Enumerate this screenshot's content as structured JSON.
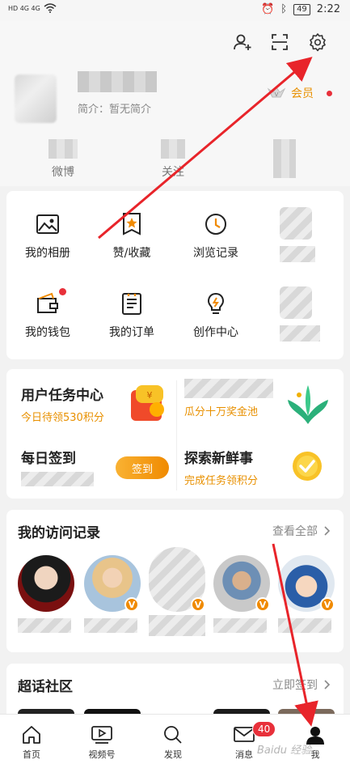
{
  "status_bar": {
    "left_text": "HD 4G 4G",
    "battery": "49",
    "time": "2:22"
  },
  "profile": {
    "intro": "简介：暂无简介",
    "vip_label": "会员",
    "stats": [
      {
        "label": "微博"
      },
      {
        "label": "关注"
      },
      {
        "label": "粉丝"
      }
    ]
  },
  "grid": {
    "items": [
      {
        "label": "我的相册",
        "icon": "photo-icon"
      },
      {
        "label": "赞/收藏",
        "icon": "star-bookmark-icon"
      },
      {
        "label": "浏览记录",
        "icon": "history-icon"
      },
      {
        "label": "草稿箱",
        "icon": "blurred-icon"
      },
      {
        "label": "我的钱包",
        "icon": "wallet-icon"
      },
      {
        "label": "我的订单",
        "icon": "order-icon"
      },
      {
        "label": "创作中心",
        "icon": "bulb-icon"
      },
      {
        "label": "粉丝服务",
        "icon": "blurred-icon"
      }
    ]
  },
  "tasks": {
    "task_center_title": "用户任务中心",
    "task_center_sub": "今日待领530积分",
    "right_top_sub": "瓜分十万奖金池",
    "left_bottom_title": "每日签到",
    "left_bottom_sub": "",
    "sign_in_button": "签到",
    "explore_title": "探索新鲜事",
    "explore_sub": "完成任务领积分"
  },
  "visits": {
    "title": "我的访问记录",
    "more": "查看全部",
    "items": [
      {
        "color": "#5a1e1e",
        "badge": ""
      },
      {
        "color": "#dcc9a4",
        "badge": "V"
      },
      {
        "color": "#b9b9b9",
        "badge": "V"
      },
      {
        "color": "#8aa9c9",
        "badge": "V"
      },
      {
        "color": "#3a7fc5",
        "badge": "V"
      }
    ]
  },
  "super_topic": {
    "title": "超话社区",
    "more": "立即签到"
  },
  "bottom_nav": {
    "items": [
      {
        "label": "首页",
        "icon": "home-icon"
      },
      {
        "label": "视频号",
        "icon": "video-icon"
      },
      {
        "label": "发现",
        "icon": "discover-icon"
      },
      {
        "label": "消息",
        "icon": "message-icon",
        "badge": "40"
      },
      {
        "label": "我",
        "icon": "profile-icon"
      }
    ]
  },
  "watermark": "Baidu 经验",
  "colors": {
    "accent_orange": "#e89000",
    "red": "#e8303a",
    "arrow": "#e8242a"
  }
}
